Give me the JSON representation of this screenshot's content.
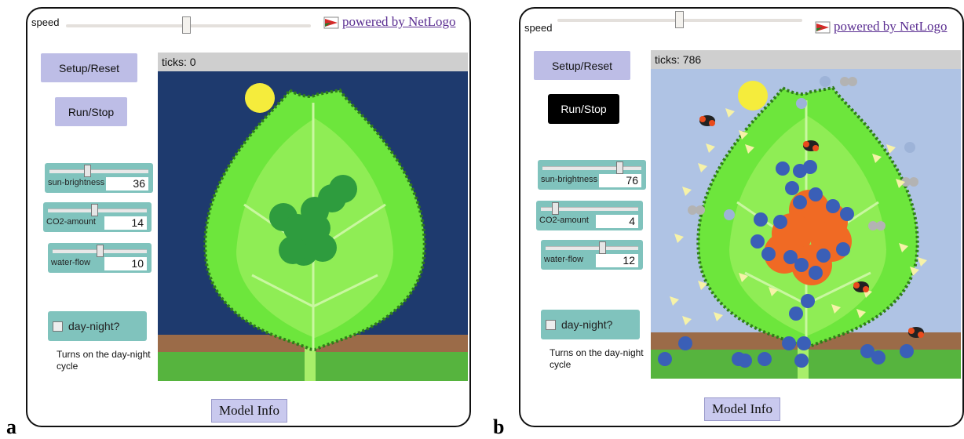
{
  "panels": [
    {
      "letter": "a",
      "speed_label": "speed",
      "netlogo_link": "powered by NetLogo",
      "setup_button": "Setup/Reset",
      "run_button": "Run/Stop",
      "run_active": false,
      "ticks_label": "ticks: 0",
      "sliders": {
        "sun": {
          "name": "sun-brightness",
          "value": "36"
        },
        "co2": {
          "name": "CO2-amount",
          "value": "14"
        },
        "water": {
          "name": "water-flow",
          "value": "10"
        }
      },
      "switch_label": "day-night?",
      "switch_on": false,
      "note": "Turns on the day-night cycle",
      "info_button": "Model Info",
      "sky_color": "#1e3a6e"
    },
    {
      "letter": "b",
      "speed_label": "speed",
      "netlogo_link": "powered by NetLogo",
      "setup_button": "Setup/Reset",
      "run_button": "Run/Stop",
      "run_active": true,
      "ticks_label": "ticks: 786",
      "sliders": {
        "sun": {
          "name": "sun-brightness",
          "value": "76"
        },
        "co2": {
          "name": "CO2-amount",
          "value": "4"
        },
        "water": {
          "name": "water-flow",
          "value": "12"
        }
      },
      "switch_label": "day-night?",
      "switch_on": false,
      "note": "Turns on the day-night cycle",
      "info_button": "Model Info",
      "sky_color": "#afc3e4"
    }
  ],
  "colors": {
    "leaf_light": "#a6f266",
    "leaf_mid": "#6de63c",
    "leaf_edge": "#2f7d19",
    "soil": "#9b6b48",
    "grass": "#56b43e",
    "sun": "#f5ec3c",
    "chloroplast": "#2e9c3e",
    "sugar_blob": "#f06a24",
    "water": "#3a5fb7",
    "light_ray": "#f6f2a8",
    "co2_gray": "#b3b3b3",
    "bug": "#e94b1d"
  }
}
